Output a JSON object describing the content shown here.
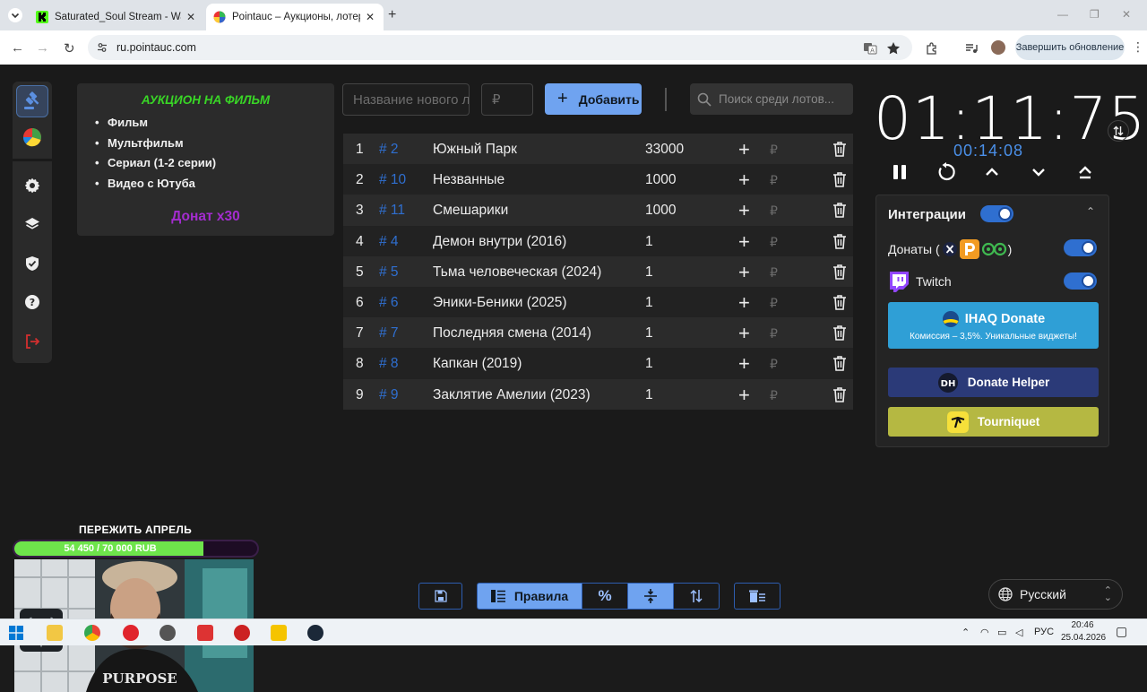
{
  "browser": {
    "tabs": [
      {
        "title": "Saturated_Soul Stream - Watch",
        "icon": "kick-icon"
      },
      {
        "title": "Pointauc – Аукционы, лотереи",
        "icon": "pointauc-icon"
      }
    ],
    "url": "ru.pointauc.com",
    "update_button": "Завершить обновление"
  },
  "rules": {
    "title": "АУКЦИОН НА ФИЛЬМ",
    "items": [
      "Фильм",
      "Мультфильм",
      "Сериал (1-2 серии)",
      "Видео с Ютуба"
    ],
    "donat": "Донат x30",
    "title_color": "#39d626",
    "donat_color": "#a42ccf"
  },
  "new_lot": {
    "name_placeholder": "Название нового лота",
    "amount_placeholder": "₽",
    "add_label": "Добавить"
  },
  "search": {
    "placeholder": "Поиск среди лотов..."
  },
  "lots": [
    {
      "num": "1",
      "id": "# 2",
      "name": "Южный Парк",
      "amount": "33000"
    },
    {
      "num": "2",
      "id": "# 10",
      "name": "Незванные",
      "amount": "1000"
    },
    {
      "num": "3",
      "id": "# 11",
      "name": "Смешарики",
      "amount": "1000"
    },
    {
      "num": "4",
      "id": "# 4",
      "name": "Демон внутри (2016)",
      "amount": "1"
    },
    {
      "num": "5",
      "id": "# 5",
      "name": "Тьма человеческая (2024)",
      "amount": "1"
    },
    {
      "num": "6",
      "id": "# 6",
      "name": "Эники-Беники (2025)",
      "amount": "1"
    },
    {
      "num": "7",
      "id": "# 7",
      "name": "Последняя смена (2014)",
      "amount": "1"
    },
    {
      "num": "8",
      "id": "# 8",
      "name": "Капкан (2019)",
      "amount": "1"
    },
    {
      "num": "9",
      "id": "# 9",
      "name": "Заклятие Амелии (2023)",
      "amount": "1"
    }
  ],
  "lot_currency": "₽",
  "timer": {
    "main": "01:11:75",
    "sub": "00:14:08"
  },
  "integrations": {
    "title": "Интеграции",
    "donations_label": "Донаты (",
    "donations_label_end": ")",
    "twitch_label": "Twitch",
    "ihaq": {
      "title": "IHAQ Donate",
      "subtitle": "Комиссия – 3,5%. Уникальные виджеты!"
    },
    "donate_helper": "Donate Helper",
    "tourniquet": "Tourniquet"
  },
  "language": "Русский",
  "bottom_toolbar": {
    "rules_label": "Правила"
  },
  "stream_overlay": {
    "goal_title": "ПЕРЕЖИТЬ АПРЕЛЬ",
    "goal_text": "54 450 / 70 000 RUB",
    "goal_fraction": 0.778
  },
  "taskbar": {
    "lang": "РУС",
    "time": "20:46",
    "date": "25.04.2026"
  },
  "colors": {
    "accent": "#6fa3f0",
    "lot_id": "#2f6fd0",
    "toggle": "#2f6fd0",
    "ihaq": "#2f9fd6",
    "donate_helper": "#2b3a78",
    "tourniquet": "#b5b842"
  }
}
